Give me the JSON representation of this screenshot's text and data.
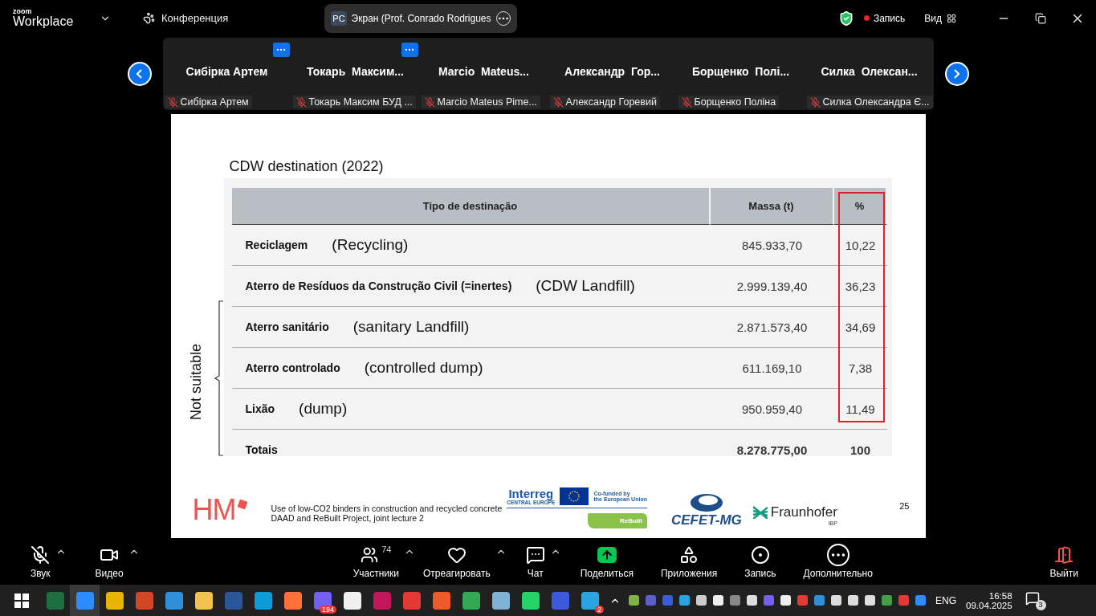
{
  "top_bar": {
    "brand_top": "zoom",
    "brand": "Workplace",
    "meeting_menu": "Конференция",
    "share_tab": {
      "initials": "PC",
      "label": "Экран (Prof. Conrado Rodrigues"
    },
    "secure": true,
    "record": "Запись",
    "view": "Вид"
  },
  "participants": [
    {
      "name": "Сибірка Артем",
      "label": "Сибірка Артем",
      "muted": true,
      "menu": true
    },
    {
      "name": "Токарь  Максим...",
      "label": "Токарь Максим БУД ...",
      "muted": true,
      "menu": true
    },
    {
      "name": "Marcio  Mateus...",
      "label": "Marcio Mateus Pime...",
      "muted": true,
      "menu": false
    },
    {
      "name": "Александр  Гор...",
      "label": "Александр Горевий",
      "muted": true,
      "menu": false
    },
    {
      "name": "Борщенко  Полі...",
      "label": "Борщенко Поліна",
      "muted": true,
      "menu": false
    },
    {
      "name": "Силка  Олексан...",
      "label": "Силка Олександра Є...",
      "muted": true,
      "menu": false
    }
  ],
  "slide": {
    "title": "CDW destination (2022)",
    "side_label": "Not suitable",
    "table": {
      "columns": [
        {
          "label": "Tipo de destinação",
          "highlighted": false
        },
        {
          "label": "Massa (t)",
          "highlighted": false
        },
        {
          "label": "%",
          "highlighted": true
        }
      ],
      "rows": [
        {
          "type": "Reciclagem",
          "translation": "(Recycling)",
          "mass": "845.933,70",
          "percent": "10,22"
        },
        {
          "type": "Aterro de Resíduos da Construção Civil (=inertes)",
          "translation": "(CDW Landfill)",
          "mass": "2.999.139,40",
          "percent": "36,23"
        },
        {
          "type": "Aterro sanitário",
          "translation": "(sanitary Landfill)",
          "mass": "2.871.573,40",
          "percent": "34,69"
        },
        {
          "type": "Aterro controlado",
          "translation": "(controlled dump)",
          "mass": "611.169,10",
          "percent": "7,38"
        },
        {
          "type": "Lixão",
          "translation": "(dump)",
          "mass": "950.959,40",
          "percent": "11,49"
        }
      ],
      "totals": {
        "label": "Totais",
        "mass": "8.278.775,00",
        "percent": "100"
      }
    },
    "footer": {
      "hm": "HM",
      "lines": [
        "Use of low-CO2 binders in construction and recycled concrete",
        "DAAD and ReBuilt Project, joint lecture 2"
      ],
      "interreg": "Interreg",
      "interreg_sub": "CENTRAL EUROPE",
      "eu": [
        "Co-funded by",
        "the European Union"
      ],
      "rebuilt": "ReBuilt",
      "cefet": "CEFET-MG",
      "fraunhofer": "Fraunhofer",
      "ibp": "IBP",
      "page": "25"
    }
  },
  "toolbar": [
    {
      "kind": "mic",
      "label": "Звук",
      "muted": true,
      "caret": true
    },
    {
      "kind": "video",
      "label": "Видео",
      "caret": true
    },
    {
      "kind": "participants",
      "label": "Участники",
      "count": "74",
      "caret": true
    },
    {
      "kind": "react",
      "label": "Отреагировать",
      "caret": true
    },
    {
      "kind": "chat",
      "label": "Чат",
      "caret": true
    },
    {
      "kind": "share",
      "label": "Поделиться",
      "caret": false
    },
    {
      "kind": "apps",
      "label": "Приложения",
      "caret": false
    },
    {
      "kind": "record",
      "label": "Запись",
      "caret": false
    },
    {
      "kind": "more",
      "label": "Дополнительно",
      "caret": false
    },
    {
      "kind": "leave",
      "label": "Выйти",
      "caret": false
    }
  ],
  "taskbar": {
    "apps": [
      {
        "color": "#1d6f42",
        "active": false
      },
      {
        "color": "#2d8cff",
        "active": true
      },
      {
        "color": "#e8b400",
        "active": false
      },
      {
        "color": "#d24726",
        "active": false
      },
      {
        "color": "#2f8fd8",
        "active": false
      },
      {
        "color": "#f2c14e",
        "active": false
      },
      {
        "color": "#2b579a",
        "active": false
      },
      {
        "color": "#0f9bd7",
        "active": false
      },
      {
        "color": "#ff7139",
        "active": false
      },
      {
        "color": "#7360f2",
        "active": false,
        "badge": "194"
      },
      {
        "color": "#f0f0f0",
        "active": false
      },
      {
        "color": "#c2185b",
        "active": false
      },
      {
        "color": "#e53935",
        "active": false
      },
      {
        "color": "#ef5a2a",
        "active": false
      },
      {
        "color": "#34a853",
        "active": false
      },
      {
        "color": "#7fb3d5",
        "active": false
      },
      {
        "color": "#25d366",
        "active": false
      },
      {
        "color": "#3b5bdb",
        "active": false
      },
      {
        "color": "#2aa3e0",
        "active": false,
        "badge": "2"
      }
    ],
    "tray": [
      {
        "color": "#7cb342"
      },
      {
        "color": "#5b5fc7"
      },
      {
        "color": "#3b5bdb"
      },
      {
        "color": "#2aa3e0"
      },
      {
        "color": "#cccccc"
      },
      {
        "color": "#eeeeee"
      },
      {
        "color": "#888888"
      },
      {
        "color": "#dddddd"
      },
      {
        "color": "#7360f2"
      },
      {
        "color": "#eeeeee"
      },
      {
        "color": "#e53935"
      },
      {
        "color": "#2f8fd8"
      },
      {
        "color": "#dddddd"
      },
      {
        "color": "#dddddd"
      },
      {
        "color": "#dddddd"
      },
      {
        "color": "#43a047"
      },
      {
        "color": "#e53935"
      },
      {
        "color": "#2d8cff"
      }
    ],
    "language": "ENG",
    "time": "16:58",
    "date": "09.04.2025",
    "notifications": "3"
  }
}
